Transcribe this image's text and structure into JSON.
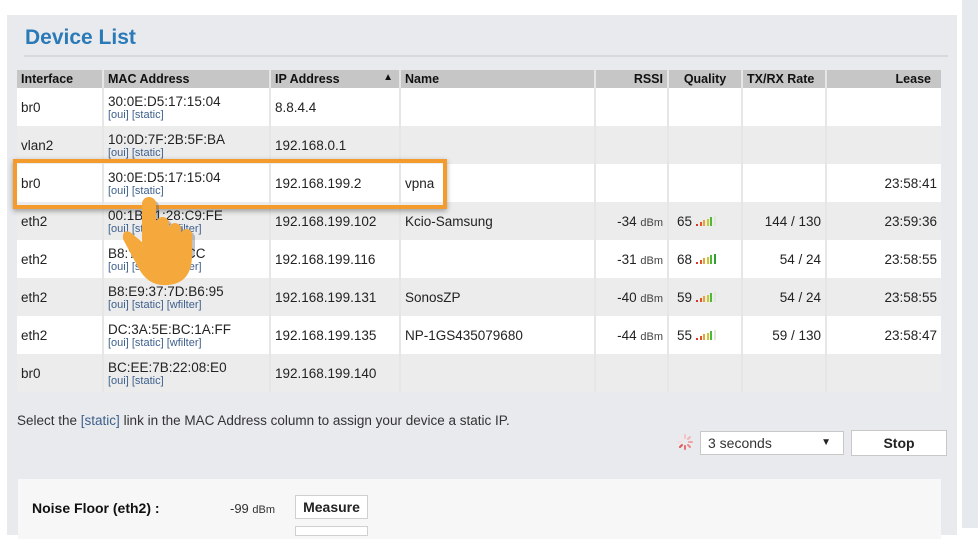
{
  "page": {
    "title": "Device List"
  },
  "table": {
    "columns": [
      {
        "label": "Interface"
      },
      {
        "label": "MAC Address"
      },
      {
        "label": "IP Address",
        "sort_indicator": "▲"
      },
      {
        "label": "Name"
      },
      {
        "label": "RSSI"
      },
      {
        "label": "Quality"
      },
      {
        "label": "TX/RX Rate"
      },
      {
        "label": "Lease"
      }
    ],
    "rows": [
      {
        "interface": "br0",
        "mac": "30:0E:D5:17:15:04",
        "links": [
          "[oui]",
          "[static]"
        ],
        "ip": "8.8.4.4",
        "name": "",
        "rssi": "",
        "rssi_unit": "",
        "quality": "",
        "txrx": "",
        "lease": ""
      },
      {
        "interface": "vlan2",
        "mac": "10:0D:7F:2B:5F:BA",
        "links": [
          "[oui]",
          "[static]"
        ],
        "ip": "192.168.0.1",
        "name": "",
        "rssi": "",
        "rssi_unit": "",
        "quality": "",
        "txrx": "",
        "lease": ""
      },
      {
        "interface": "br0",
        "mac": "30:0E:D5:17:15:04",
        "links": [
          "[oui]",
          "[static]"
        ],
        "ip": "192.168.199.2",
        "name": "vpna",
        "rssi": "",
        "rssi_unit": "",
        "quality": "",
        "txrx": "",
        "lease": "23:58:41",
        "highlighted": true
      },
      {
        "interface": "eth2",
        "mac": "00:1B:?1:28:C9:FE",
        "links": [
          "[oui]",
          "[static]",
          "[wfilter]"
        ],
        "ip": "192.168.199.102",
        "name": "Kcio-Samsung",
        "rssi": "-34",
        "rssi_unit": "dBm",
        "quality": "65",
        "quality_pct": 65,
        "txrx": "144 / 130",
        "lease": "23:59:36"
      },
      {
        "interface": "eth2",
        "mac": "B8:??:??:7E:CC",
        "links": [
          "[oui]",
          "[static]",
          "[wfilter]"
        ],
        "ip": "192.168.199.116",
        "name": "",
        "rssi": "-31",
        "rssi_unit": "dBm",
        "quality": "68",
        "quality_pct": 68,
        "txrx": "54 / 24",
        "lease": "23:58:55"
      },
      {
        "interface": "eth2",
        "mac": "B8:E9:37:7D:B6:95",
        "links": [
          "[oui]",
          "[static]",
          "[wfilter]"
        ],
        "ip": "192.168.199.131",
        "name": "SonosZP",
        "rssi": "-40",
        "rssi_unit": "dBm",
        "quality": "59",
        "quality_pct": 59,
        "txrx": "54 / 24",
        "lease": "23:58:55"
      },
      {
        "interface": "eth2",
        "mac": "DC:3A:5E:BC:1A:FF",
        "links": [
          "[oui]",
          "[static]",
          "[wfilter]"
        ],
        "ip": "192.168.199.135",
        "name": "NP-1GS435079680",
        "rssi": "-44",
        "rssi_unit": "dBm",
        "quality": "55",
        "quality_pct": 55,
        "txrx": "59 / 130",
        "lease": "23:58:47"
      },
      {
        "interface": "br0",
        "mac": "BC:EE:7B:22:08:E0",
        "links": [
          "[oui]",
          "[static]"
        ],
        "ip": "192.168.199.140",
        "name": "",
        "rssi": "",
        "rssi_unit": "",
        "quality": "",
        "txrx": "",
        "lease": ""
      }
    ]
  },
  "hint": {
    "prefix": "Select the ",
    "link": "[static]",
    "suffix": " link in the MAC Address column to assign your device a static IP."
  },
  "refresh": {
    "interval_selected": "3 seconds",
    "stop_label": "Stop"
  },
  "noise": {
    "label": "Noise Floor (eth2) :",
    "value": "-99",
    "unit": "dBm",
    "measure_label": "Measure"
  },
  "colors": {
    "title": "#2a7ab8",
    "link": "#3d5f8c",
    "highlight": "#f39c2d"
  }
}
